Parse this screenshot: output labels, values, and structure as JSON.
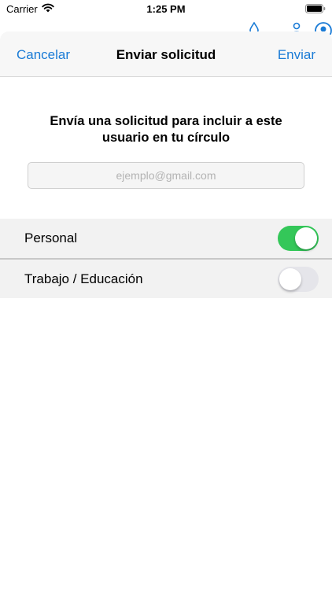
{
  "status_bar": {
    "carrier": "Carrier",
    "time": "1:25 PM",
    "wifi_icon": "wifi-icon",
    "battery_icon": "battery-full-icon"
  },
  "sheet": {
    "nav": {
      "cancel_label": "Cancelar",
      "title": "Enviar solicitud",
      "send_label": "Enviar",
      "accent_color": "#1a7bd6"
    },
    "prompt": "Envía una solicitud para incluir a este usuario en tu círculo",
    "email": {
      "value": "",
      "placeholder": "ejemplo@gmail.com"
    },
    "toggles": [
      {
        "label": "Personal",
        "on": true
      },
      {
        "label": "Trabajo / Educación",
        "on": false
      }
    ],
    "toggle_on_color": "#34c759"
  }
}
